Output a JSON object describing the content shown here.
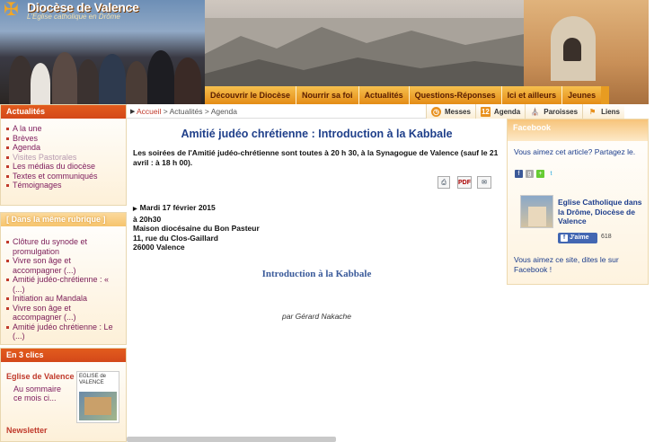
{
  "header": {
    "logo_name": "Diocèse de Valence",
    "logo_tagline": "L'Eglise catholique en Drôme"
  },
  "main_nav": [
    "Découvrir le Diocèse",
    "Nourrir sa foi",
    "Actualités",
    "Questions-Réponses",
    "Ici et ailleurs",
    "Jeunes"
  ],
  "breadcrumb": {
    "home": "Accueil",
    "rest": "> Actualités > Agenda"
  },
  "toolbar": [
    {
      "label": "Messes",
      "icon": "clock-icon"
    },
    {
      "label": "Agenda",
      "icon": "calendar-icon",
      "badge": "12"
    },
    {
      "label": "Paroisses",
      "icon": "church-icon"
    },
    {
      "label": "Liens",
      "icon": "flag-icon"
    }
  ],
  "sidebar": {
    "news_title": "Actualités",
    "news_items": [
      "A la une",
      "Brèves",
      "Agenda",
      "Visites Pastorales",
      "Les médias du diocèse",
      "Textes et communiqués",
      "Témoignages"
    ],
    "same_title": "[ Dans la même rubrique ]",
    "same_items": [
      "Clôture du synode et promulgation",
      "Vivre son âge et accompagner (...)",
      "Amitié judéo-chrétienne : « (...)",
      "Initiation au Mandala",
      "Vivre son âge et accompagner (...)",
      "Amitié judéo chrétienne : Le (...)"
    ],
    "clics_title": "En 3 clics",
    "eglise_title": "Eglise de Valence",
    "eglise_link": "Au sommaire ce mois ci...",
    "eglise_thumb": "EGLISE de VALENCE",
    "newsletter": "Newsletter"
  },
  "article": {
    "title": "Amitié judéo chrétienne : Introduction à la Kabbale",
    "intro": "Les soirées de l'Amitié judéo-chrétienne sont toutes à 20 h 30, à la Synagogue de Valence (sauf le 21 avril : à 18 h 00).",
    "actions": {
      "print": "print-icon",
      "pdf": "PDF",
      "email": "email-icon"
    },
    "event_date": "Mardi 17 février 2015",
    "event_lines": [
      "à 20h30",
      "Maison diocésaine du Bon Pasteur",
      "11, rue du Clos-Gaillard",
      "26000 Valence"
    ],
    "subtitle": "Introduction à la Kabbale",
    "author": "par Gérard Nakache"
  },
  "facebook": {
    "title": "Facebook",
    "like_article": "Vous aimez cet article? Partagez le.",
    "page_name": "Eglise Catholique dans la Drôme, Diocèse de Valence",
    "like_label": "J'aime",
    "like_count": "618",
    "like_site": "Vous aimez ce site, dites le sur Facebook !"
  }
}
